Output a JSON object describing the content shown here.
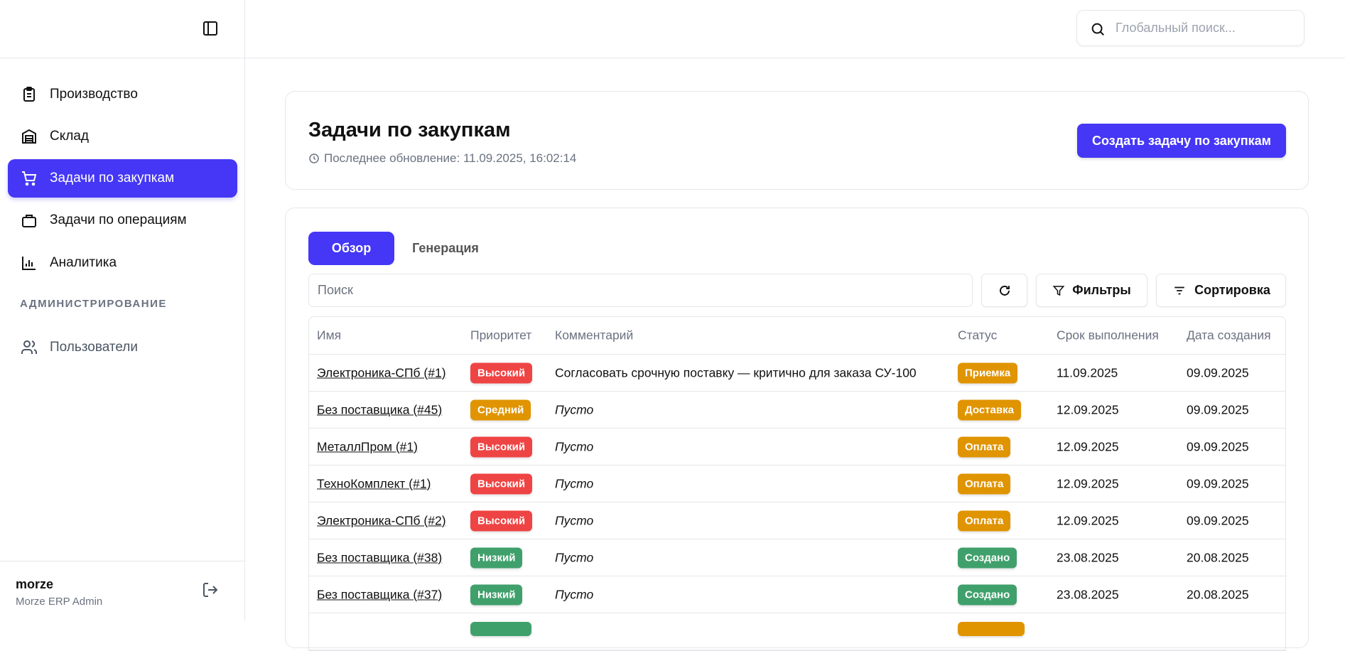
{
  "sidebar": {
    "items": [
      {
        "label": "Производство",
        "icon": "clipboard-icon"
      },
      {
        "label": "Склад",
        "icon": "warehouse-icon"
      },
      {
        "label": "Задачи по закупкам",
        "icon": "cart-icon",
        "active": true
      },
      {
        "label": "Задачи по операциям",
        "icon": "briefcase-icon"
      },
      {
        "label": "Аналитика",
        "icon": "bar-chart-icon"
      }
    ],
    "admin_section": "АДМИНИСТРИРОВАНИЕ",
    "admin_items": [
      {
        "label": "Пользователи",
        "icon": "users-icon"
      }
    ],
    "user": {
      "name": "morze",
      "role": "Morze ERP Admin"
    }
  },
  "topbar": {
    "search_placeholder": "Глобальный поиск..."
  },
  "header": {
    "title": "Задачи по закупкам",
    "updated": "Последнее обновление: 11.09.2025, 16:02:14",
    "create_button": "Создать задачу по закупкам"
  },
  "tabs": [
    "Обзор",
    "Генерация"
  ],
  "toolbar": {
    "search_placeholder": "Поиск",
    "filters": "Фильтры",
    "sort": "Сортировка"
  },
  "colors": {
    "accent": "#4537f5",
    "high": "#ef4444",
    "medium": "#e09400",
    "low": "#40a06c"
  },
  "table": {
    "columns": [
      "Имя",
      "Приоритет",
      "Комментарий",
      "Статус",
      "Срок выполнения",
      "Дата создания"
    ],
    "rows": [
      {
        "name": "Электроника-СПб (#1)",
        "priority": "Высокий",
        "pcolor": "#ef4444",
        "comment": "Согласовать срочную поставку — критично для заказа СУ-100",
        "empty": false,
        "status": "Приемка",
        "scolor": "#e09400",
        "due": "11.09.2025",
        "created": "09.09.2025"
      },
      {
        "name": "Без поставщика (#45)",
        "priority": "Средний",
        "pcolor": "#e09400",
        "comment": "Пусто",
        "empty": true,
        "status": "Доставка",
        "scolor": "#e09400",
        "due": "12.09.2025",
        "created": "09.09.2025"
      },
      {
        "name": "МеталлПром (#1)",
        "priority": "Высокий",
        "pcolor": "#ef4444",
        "comment": "Пусто",
        "empty": true,
        "status": "Оплата",
        "scolor": "#e09400",
        "due": "12.09.2025",
        "created": "09.09.2025"
      },
      {
        "name": "ТехноКомплект (#1)",
        "priority": "Высокий",
        "pcolor": "#ef4444",
        "comment": "Пусто",
        "empty": true,
        "status": "Оплата",
        "scolor": "#e09400",
        "due": "12.09.2025",
        "created": "09.09.2025"
      },
      {
        "name": "Электроника-СПб (#2)",
        "priority": "Высокий",
        "pcolor": "#ef4444",
        "comment": "Пусто",
        "empty": true,
        "status": "Оплата",
        "scolor": "#e09400",
        "due": "12.09.2025",
        "created": "09.09.2025"
      },
      {
        "name": "Без поставщика (#38)",
        "priority": "Низкий",
        "pcolor": "#40a06c",
        "comment": "Пусто",
        "empty": true,
        "status": "Создано",
        "scolor": "#40a06c",
        "due": "23.08.2025",
        "created": "20.08.2025"
      },
      {
        "name": "Без поставщика (#37)",
        "priority": "Низкий",
        "pcolor": "#40a06c",
        "comment": "Пусто",
        "empty": true,
        "status": "Создано",
        "scolor": "#40a06c",
        "due": "23.08.2025",
        "created": "20.08.2025"
      }
    ]
  }
}
